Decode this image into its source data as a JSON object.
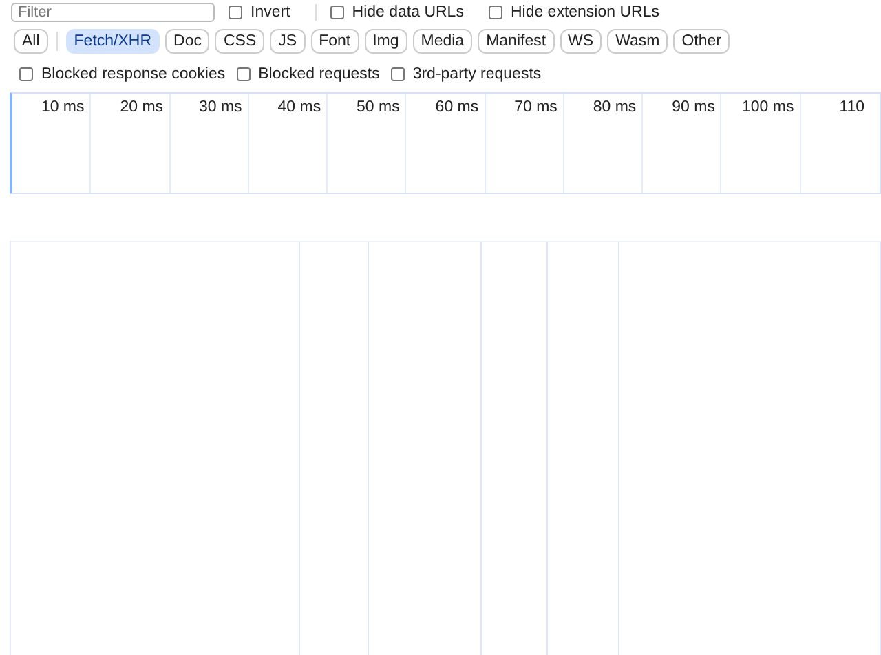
{
  "filter_bar": {
    "filter": {
      "placeholder": "Filter"
    },
    "options": [
      {
        "label": "Invert",
        "checked": false
      },
      {
        "label": "Hide data URLs",
        "checked": false
      },
      {
        "label": "Hide extension URLs",
        "checked": false
      }
    ]
  },
  "type_filters": [
    {
      "label": "All",
      "selected": false
    },
    {
      "label": "Fetch/XHR",
      "selected": true
    },
    {
      "label": "Doc",
      "selected": false
    },
    {
      "label": "CSS",
      "selected": false
    },
    {
      "label": "JS",
      "selected": false
    },
    {
      "label": "Font",
      "selected": false
    },
    {
      "label": "Img",
      "selected": false
    },
    {
      "label": "Media",
      "selected": false
    },
    {
      "label": "Manifest",
      "selected": false
    },
    {
      "label": "WS",
      "selected": false
    },
    {
      "label": "Wasm",
      "selected": false
    },
    {
      "label": "Other",
      "selected": false
    }
  ],
  "request_filters": [
    {
      "label": "Blocked response cookies",
      "checked": false
    },
    {
      "label": "Blocked requests",
      "checked": false
    },
    {
      "label": "3rd-party requests",
      "checked": false
    }
  ],
  "overview": {
    "ticks": [
      "10 ms",
      "20 ms",
      "30 ms",
      "40 ms",
      "50 ms",
      "60 ms",
      "70 ms",
      "80 ms",
      "90 ms",
      "100 ms",
      "110"
    ]
  }
}
